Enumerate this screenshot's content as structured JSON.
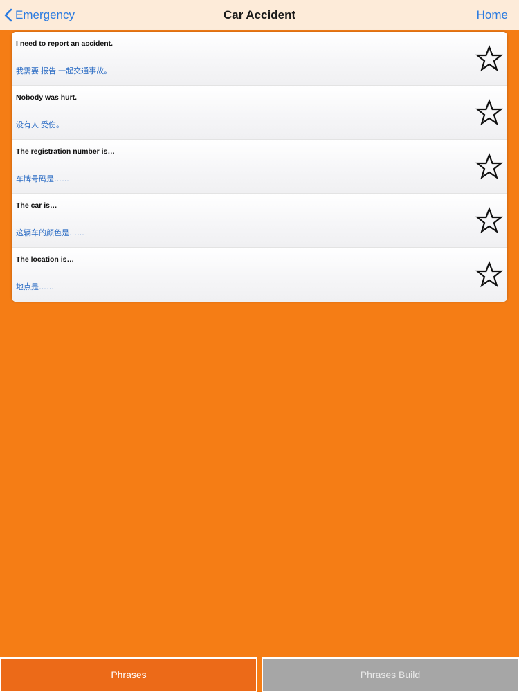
{
  "navbar": {
    "back_label": "Emergency",
    "title": "Car Accident",
    "home_label": "Home"
  },
  "phrases": [
    {
      "en": "I need to report an accident.",
      "zh": "我需要 报告 一起交通事故。",
      "favorite": false
    },
    {
      "en": "Nobody was hurt.",
      "zh": "没有人 受伤。",
      "favorite": false
    },
    {
      "en": "The registration number is…",
      "zh": "车牌号码是……",
      "favorite": false
    },
    {
      "en": "The car is…",
      "zh": "这辆车的颜色是……",
      "favorite": false
    },
    {
      "en": "The location is…",
      "zh": "地点是……",
      "favorite": false
    }
  ],
  "tabs": [
    {
      "label": "Phrases",
      "selected": true
    },
    {
      "label": "Phrases Build",
      "selected": false
    }
  ],
  "colors": {
    "background": "#F57D15",
    "navbar": "#FDEBD9",
    "link": "#2B7BE0",
    "chinese_text": "#2B6CC4",
    "tab_selected": "#EC6A18",
    "tab_unselected": "#A6A6A6"
  },
  "icons": {
    "back": "chevron-left-icon",
    "favorite": "star-outline-icon"
  }
}
